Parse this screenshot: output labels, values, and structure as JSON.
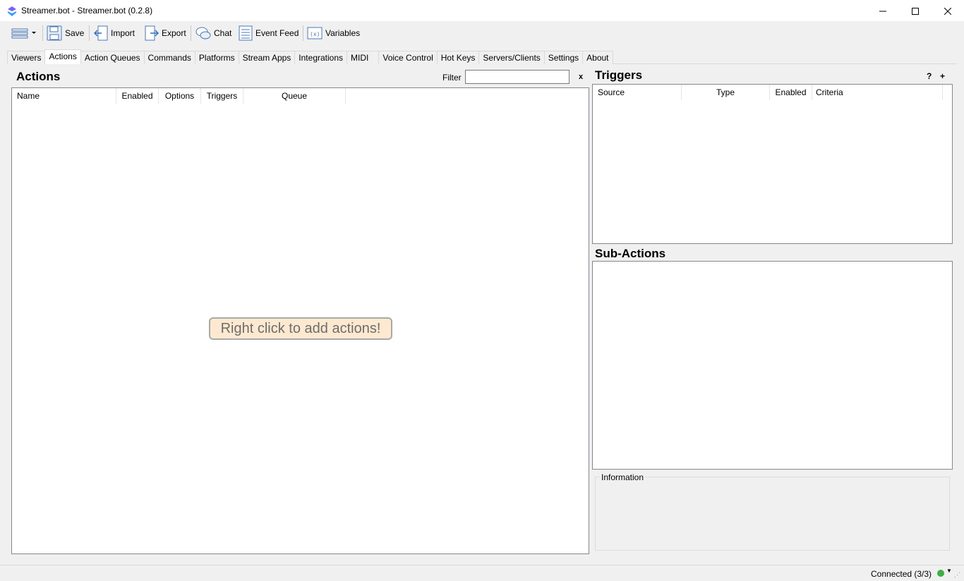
{
  "window": {
    "title": "Streamer.bot - Streamer.bot (0.2.8)"
  },
  "toolbar": {
    "save": "Save",
    "import": "Import",
    "export": "Export",
    "chat": "Chat",
    "event_feed": "Event Feed",
    "variables": "Variables"
  },
  "tabs": [
    "Viewers",
    "Actions",
    "Action Queues",
    "Commands",
    "Platforms",
    "Stream Apps",
    "Integrations",
    "MIDI",
    "Voice Control",
    "Hot Keys",
    "Servers/Clients",
    "Settings",
    "About"
  ],
  "active_tab": "Actions",
  "actions": {
    "title": "Actions",
    "filter_label": "Filter",
    "filter_value": "",
    "filter_clear": "x",
    "columns": [
      "Name",
      "Enabled",
      "Options",
      "Triggers",
      "Queue"
    ],
    "empty_hint": "Right click to add actions!"
  },
  "triggers": {
    "title": "Triggers",
    "help": "?",
    "add": "+",
    "columns": [
      "Source",
      "Type",
      "Enabled",
      "Criteria"
    ]
  },
  "sub_actions": {
    "title": "Sub-Actions"
  },
  "information": {
    "label": "Information"
  },
  "status": {
    "text": "Connected (3/3)",
    "color": "#3cb043"
  },
  "icons": {
    "app": "streamerbot-logo-icon",
    "menu": "hamburger-menu-icon",
    "save": "floppy-disk-icon",
    "import": "import-arrow-icon",
    "export": "export-arrow-icon",
    "chat": "chat-bubble-icon",
    "event_feed": "list-document-icon",
    "variables": "variables-icon"
  }
}
